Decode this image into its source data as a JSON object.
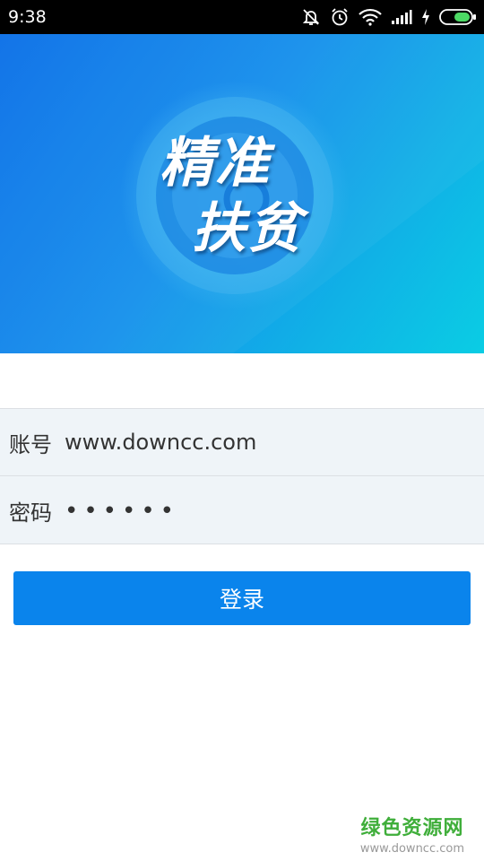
{
  "status_bar": {
    "time": "9:38",
    "icons": [
      "mute-bell-icon",
      "alarm-icon",
      "wifi-icon",
      "signal-icon",
      "charging-icon",
      "battery-icon"
    ],
    "battery_color": "#4cd964"
  },
  "banner": {
    "title_line1": "精准",
    "title_line2": "扶贫",
    "gradient_start": "#0a6fe8",
    "gradient_end": "#0acde4"
  },
  "form": {
    "account_label": "账号",
    "account_value": "www.downcc.com",
    "password_label": "密码",
    "password_value": "••••••"
  },
  "login_button": {
    "label": "登录",
    "color": "#0a84ec"
  },
  "watermark": {
    "name": "绿色资源网",
    "url": "www.downcc.com",
    "color": "#3fae3a"
  }
}
